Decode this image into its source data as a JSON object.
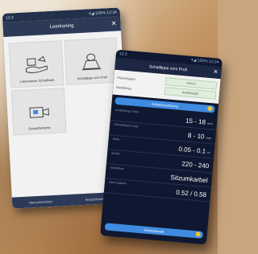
{
  "phone1": {
    "status_left": "12:3",
    "status_right": "▾◢ 100% 12:34",
    "title": "Leerkoning",
    "close": "✕",
    "tiles": [
      {
        "label": "Lebensteuer Schaltkasb",
        "icon": "hand-with-item-icon"
      },
      {
        "label": "Schaltlippe vom Profi",
        "icon": "device-icon"
      },
      {
        "label": "Designfarbstrat",
        "icon": "machine-icon"
      }
    ],
    "footer": [
      "Interconnecktion",
      "Ansatz/Kante/Gerte"
    ]
  },
  "phone2": {
    "status_left": "12:3",
    "status_right": "▾◢ 100% 12:34",
    "title": "Schaltlippe vom Profi",
    "close": "✕",
    "inputs": [
      {
        "label": "Fliesenlagen",
        "value": "Fliesen"
      },
      {
        "label": "Bett/Belag",
        "value": "Bett/Belag(8)"
      }
    ],
    "calc_button": "Anbieterauslösung",
    "results": [
      {
        "label": "Schließlänge Rand",
        "value": "15 - 18",
        "unit": "mm"
      },
      {
        "label": "Schließlänge Kante",
        "value": "8 - 10",
        "unit": "mm"
      },
      {
        "label": "Dicke",
        "value": "0.05 - 0.1",
        "unit": "m"
      },
      {
        "label": "Schlitz",
        "value": "220 - 240",
        "unit": ""
      },
      {
        "label": "Schaltlippe",
        "value": "Sitzumkarbel",
        "unit": ""
      },
      {
        "label": "Nachzugstelle",
        "value": "0.52 / 0.58",
        "unit": ""
      }
    ],
    "bottom_button": "Marktplapsatti"
  },
  "colors": {
    "navy": "#2c3a57",
    "dark_navy": "#0f1830",
    "accent_blue": "#3f8be0",
    "accent_yellow": "#f2c230",
    "field_green": "#dfeedd"
  }
}
